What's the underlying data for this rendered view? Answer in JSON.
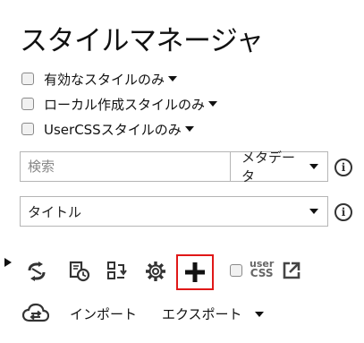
{
  "title": "スタイルマネージャ",
  "filters": [
    {
      "label": "有効なスタイルのみ",
      "checked": false
    },
    {
      "label": "ローカル作成スタイルのみ",
      "checked": false
    },
    {
      "label": "UserCSSスタイルのみ",
      "checked": false
    }
  ],
  "search": {
    "placeholder": "検索",
    "mode": "メタデータ"
  },
  "sort": {
    "value": "タイトル"
  },
  "info_glyph": "i",
  "usercss": {
    "line1": "user",
    "line2": "CSS",
    "checked": false
  },
  "actions": {
    "import_label": "インポート",
    "export_label": "エクスポート"
  },
  "toolbar_icons": [
    "expand-arrow-icon",
    "update-check-icon",
    "history-icon",
    "backup-icon",
    "gear-icon",
    "plus-icon",
    "external-link-icon",
    "sync-icon"
  ],
  "colors": {
    "highlight": "#e01818"
  }
}
